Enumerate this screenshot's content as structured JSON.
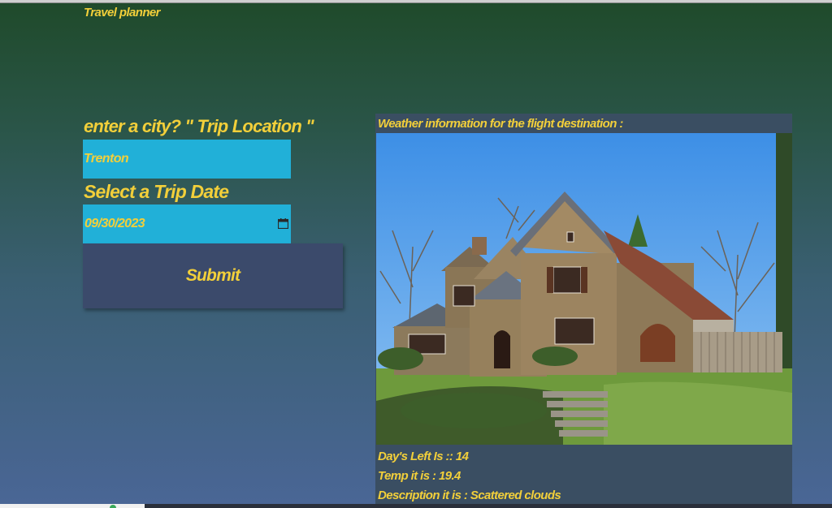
{
  "app": {
    "title": "Travel planner"
  },
  "form": {
    "city_label": "enter a city? \" Trip Location \"",
    "city_value": "Trenton",
    "date_label": "Select a Trip Date",
    "date_value": "09/30/2023",
    "submit_label": "Submit"
  },
  "weather": {
    "heading": "Weather information for the flight destination :",
    "days_left": "Day's Left Is :: 14",
    "temp": "Temp it is : 19.4",
    "description": "Description it is : Scattered clouds"
  },
  "colors": {
    "text_accent": "#f2cf3a",
    "input_bg": "#21b0d8",
    "button_bg": "#3b4a6b",
    "card_bg": "#3a4e62"
  },
  "icons": {
    "date_picker": "calendar-icon"
  }
}
